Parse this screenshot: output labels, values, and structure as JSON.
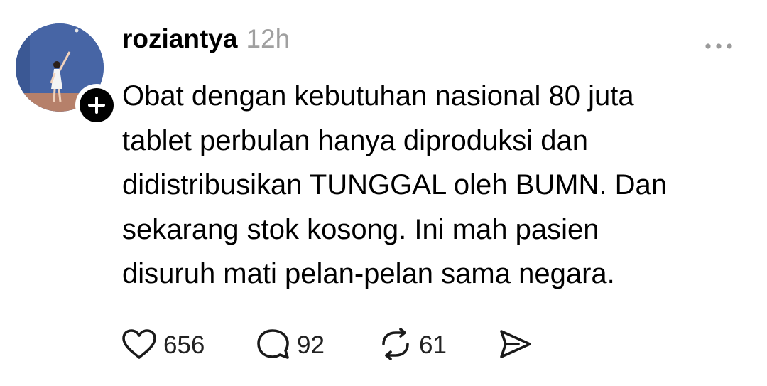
{
  "post": {
    "author": {
      "username": "roziantya",
      "avatar_icon": "avatar-photo",
      "follow_icon": "plus-icon"
    },
    "time": "12h",
    "more_icon": "more-icon",
    "text_lines": [
      "Obat dengan kebutuhan nasional 80 juta",
      "tablet perbulan hanya diproduksi dan",
      "didistribusikan TUNGGAL oleh BUMN. Dan",
      "sekarang stok kosong. Ini mah pasien",
      "disuruh mati pelan-pelan sama negara."
    ],
    "actions": {
      "likes": "656",
      "comments": "92",
      "reposts": "61",
      "like_icon": "heart-icon",
      "comment_icon": "comment-icon",
      "repost_icon": "repost-icon",
      "share_icon": "share-icon"
    }
  }
}
